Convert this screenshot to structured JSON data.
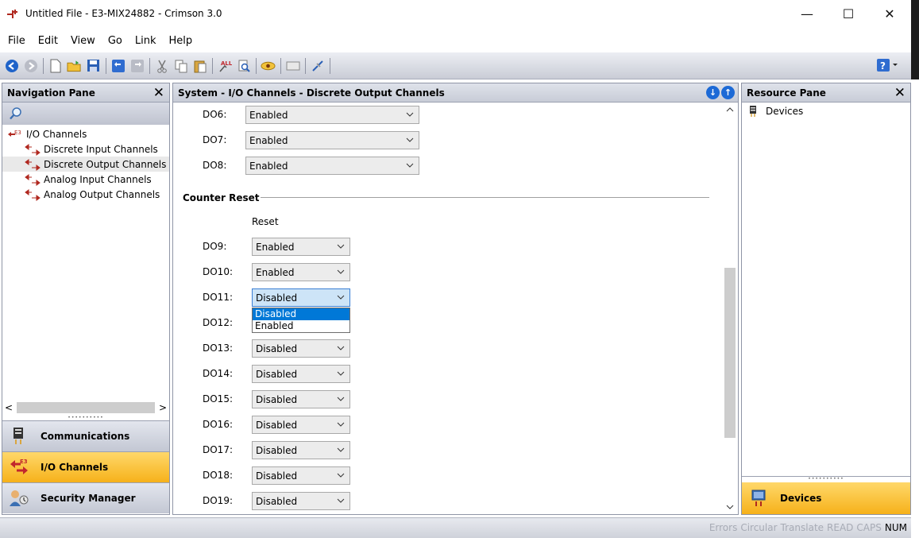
{
  "window": {
    "title": "Untitled File - E3-MIX24882 - Crimson 3.0",
    "minimize": "—",
    "maximize": "☐",
    "close": "✕"
  },
  "menu": [
    "File",
    "Edit",
    "View",
    "Go",
    "Link",
    "Help"
  ],
  "nav_pane": {
    "title": "Navigation Pane",
    "close": "✕",
    "tree": {
      "root": "I/O Channels",
      "children": [
        "Discrete Input Channels",
        "Discrete Output Channels",
        "Analog Input Channels",
        "Analog Output Channels"
      ]
    },
    "categories": [
      "Communications",
      "I/O Channels",
      "Security Manager"
    ],
    "scroll_left": "<",
    "scroll_right": ">"
  },
  "main_pane": {
    "title": "System - I/O Channels - Discrete Output Channels",
    "top_rows": [
      {
        "label": "DO6:",
        "value": "Enabled"
      },
      {
        "label": "DO7:",
        "value": "Enabled"
      },
      {
        "label": "DO8:",
        "value": "Enabled"
      }
    ],
    "group_title": "Counter Reset",
    "column_header": "Reset",
    "reset_rows": [
      {
        "label": "DO9:",
        "value": "Enabled"
      },
      {
        "label": "DO10:",
        "value": "Enabled"
      },
      {
        "label": "DO11:",
        "value": "Disabled"
      },
      {
        "label": "DO12:",
        "value": ""
      },
      {
        "label": "DO13:",
        "value": "Disabled"
      },
      {
        "label": "DO14:",
        "value": "Disabled"
      },
      {
        "label": "DO15:",
        "value": "Disabled"
      },
      {
        "label": "DO16:",
        "value": "Disabled"
      },
      {
        "label": "DO17:",
        "value": "Disabled"
      },
      {
        "label": "DO18:",
        "value": "Disabled"
      },
      {
        "label": "DO19:",
        "value": "Disabled"
      }
    ],
    "open_dropdown": {
      "options": [
        "Disabled",
        "Enabled"
      ],
      "highlighted": "Disabled"
    }
  },
  "resource_pane": {
    "title": "Resource Pane",
    "close": "✕",
    "items": [
      "Devices"
    ],
    "bottom_button": "Devices"
  },
  "status_bar": {
    "items": [
      {
        "text": "Errors",
        "active": false
      },
      {
        "text": "Circular",
        "active": false
      },
      {
        "text": "Translate",
        "active": false
      },
      {
        "text": "READ",
        "active": false
      },
      {
        "text": "CAPS",
        "active": false
      },
      {
        "text": "NUM",
        "active": true
      }
    ]
  },
  "colors": {
    "accent_blue": "#0078d7",
    "active_category": "#f6b11a",
    "header_gradient": "#c8ccd7"
  }
}
